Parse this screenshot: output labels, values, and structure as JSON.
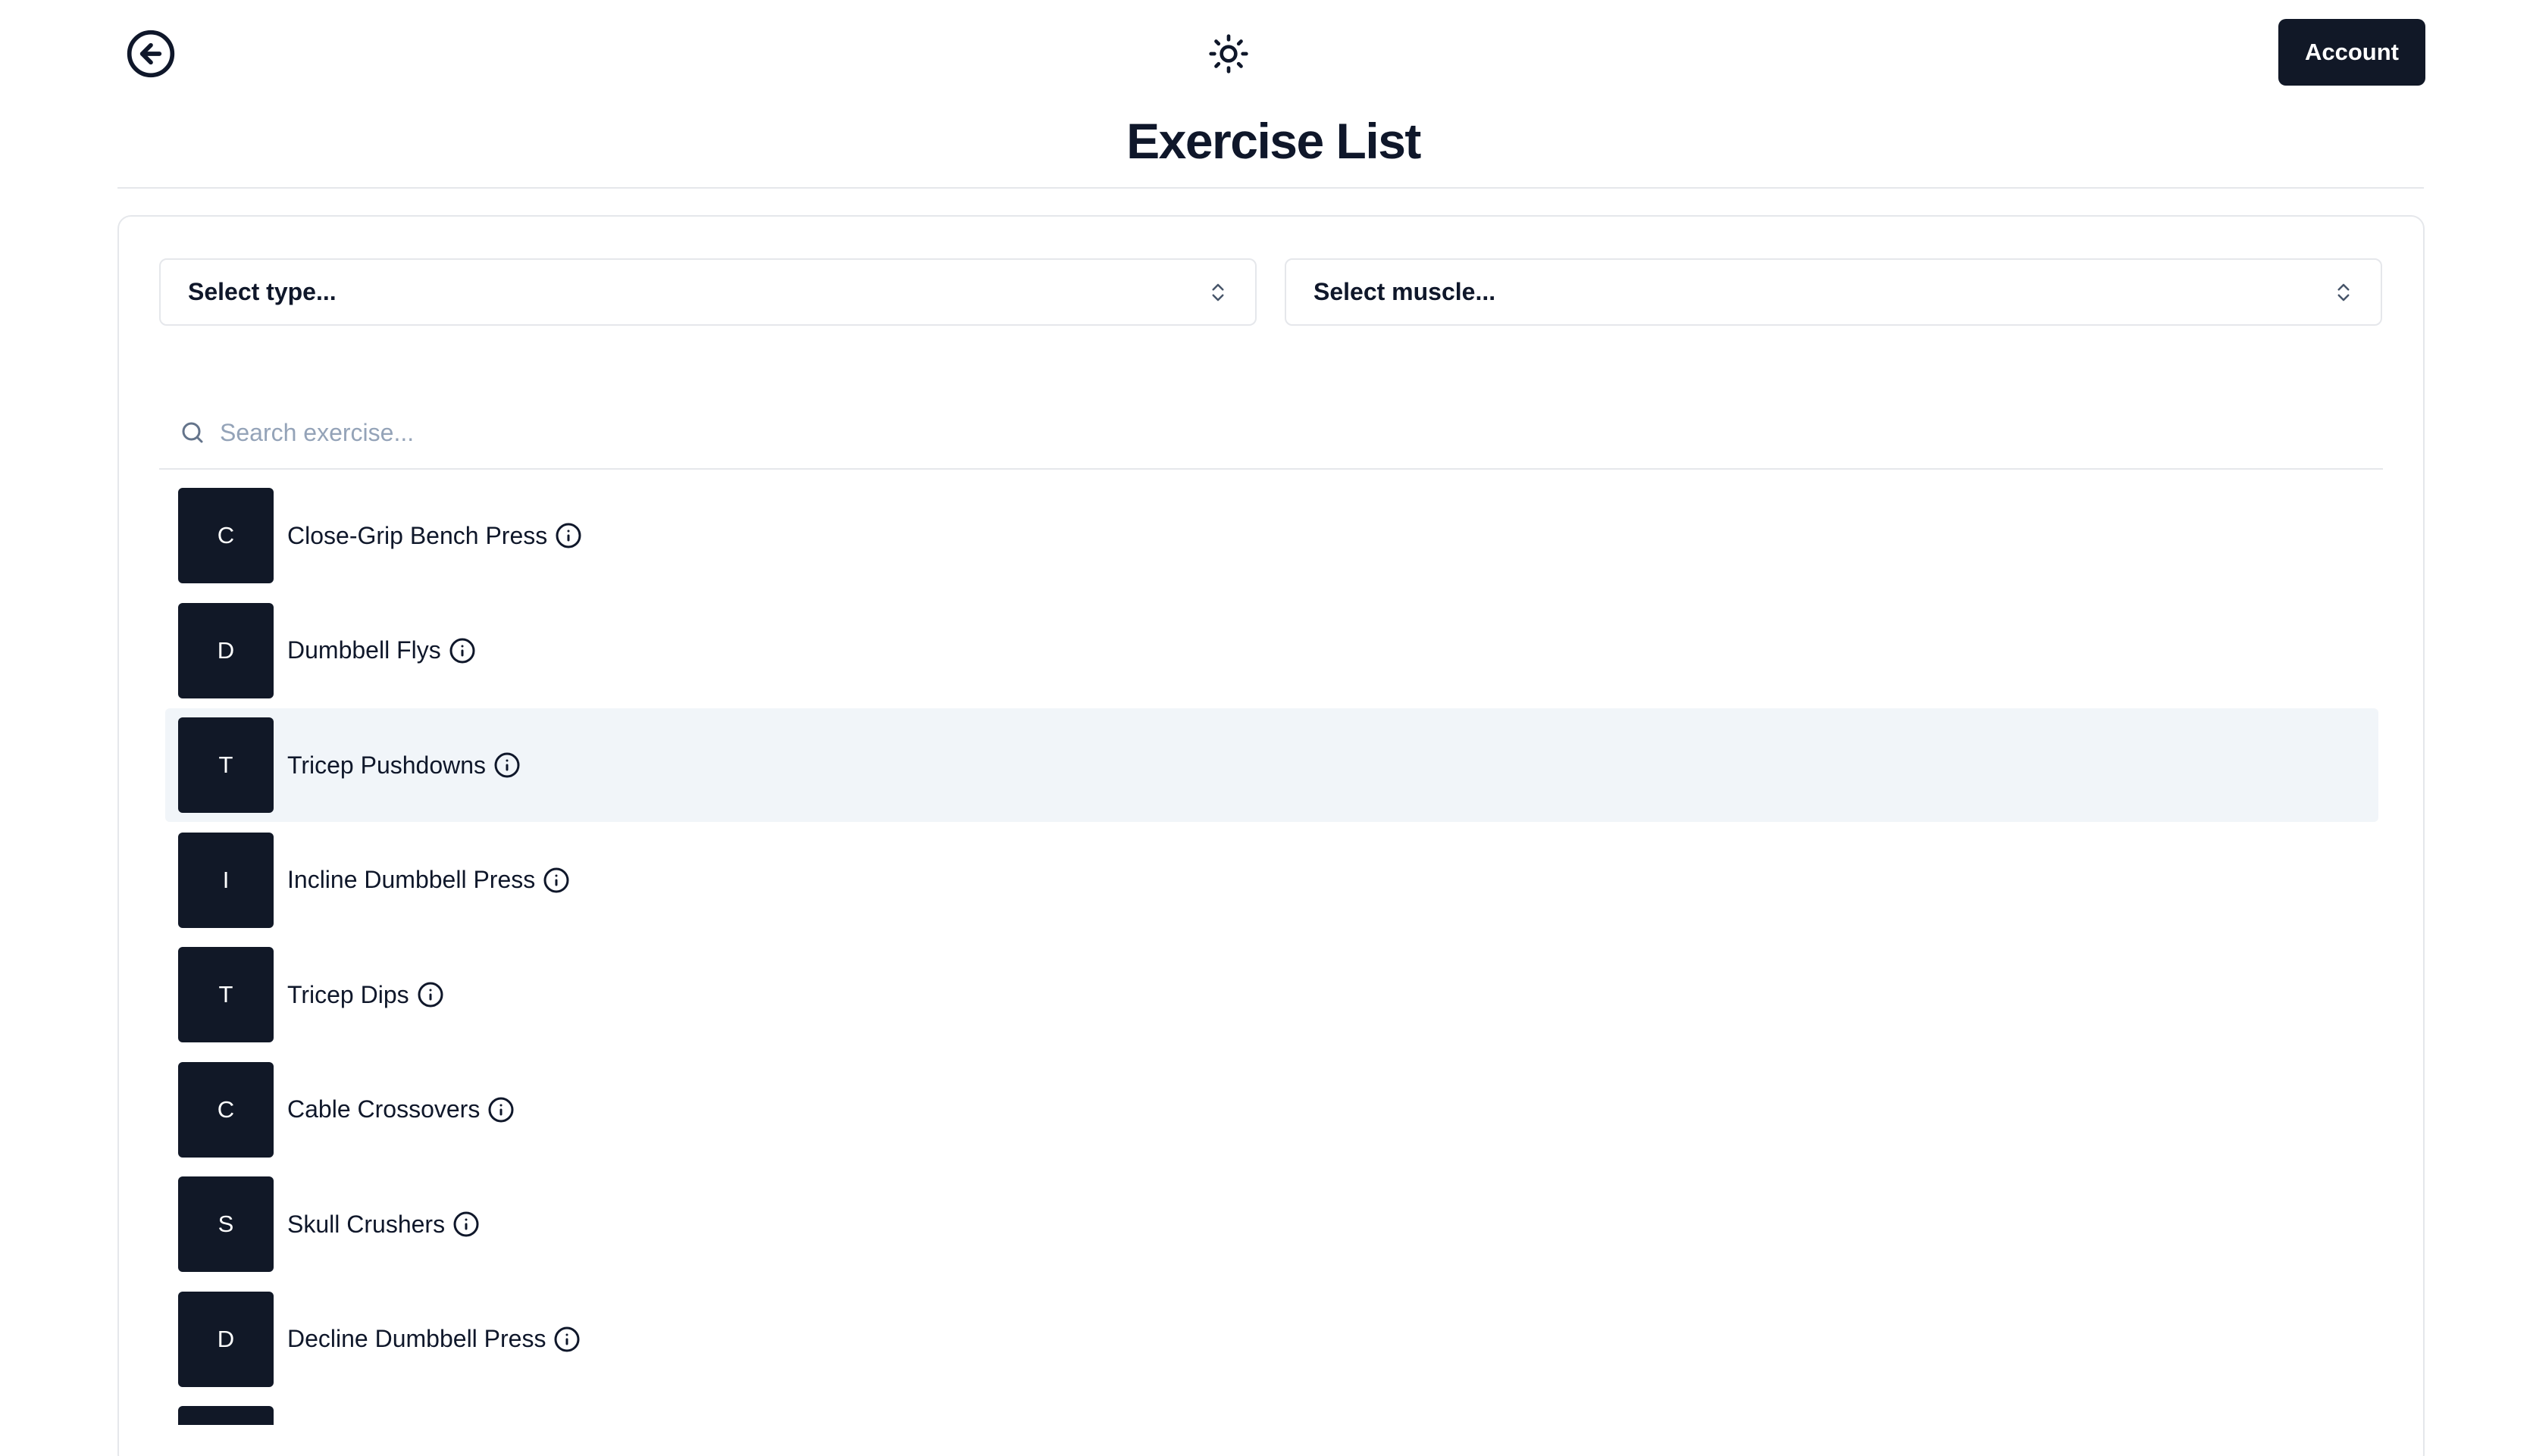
{
  "header": {
    "back_icon": "arrow-left-circle-icon",
    "theme_icon": "sun-icon",
    "account_label": "Account",
    "title": "Exercise List"
  },
  "filters": {
    "type_placeholder": "Select type...",
    "muscle_placeholder": "Select muscle..."
  },
  "search": {
    "placeholder": "Search exercise...",
    "value": ""
  },
  "exercises": [
    {
      "initial": "C",
      "name": "Close-Grip Bench Press",
      "highlighted": false
    },
    {
      "initial": "D",
      "name": "Dumbbell Flys",
      "highlighted": false
    },
    {
      "initial": "T",
      "name": "Tricep Pushdowns",
      "highlighted": true
    },
    {
      "initial": "I",
      "name": "Incline Dumbbell Press",
      "highlighted": false
    },
    {
      "initial": "T",
      "name": "Tricep Dips",
      "highlighted": false
    },
    {
      "initial": "C",
      "name": "Cable Crossovers",
      "highlighted": false
    },
    {
      "initial": "S",
      "name": "Skull Crushers",
      "highlighted": false
    },
    {
      "initial": "D",
      "name": "Decline Dumbbell Press",
      "highlighted": false
    },
    {
      "initial": "",
      "name": "",
      "highlighted": false
    }
  ],
  "colors": {
    "primary": "#111827",
    "highlight": "#f1f5f9",
    "border": "#e5e7eb",
    "muted": "#94a3b8"
  }
}
